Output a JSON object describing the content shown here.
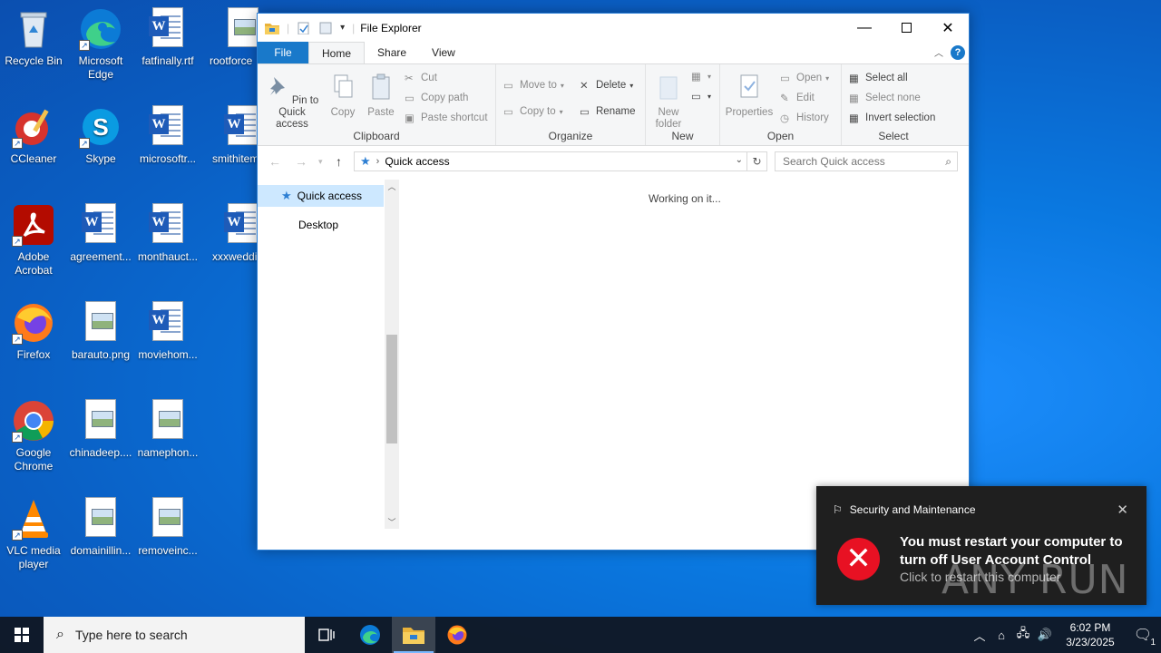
{
  "desktop": {
    "icons": [
      {
        "label": "Recycle Bin",
        "icon": "recycle-bin-icon"
      },
      {
        "label": "Microsoft Edge",
        "icon": "edge-icon"
      },
      {
        "label": "fatfinally.rtf",
        "icon": "word-doc-icon"
      },
      {
        "label": "rootforce",
        "icon": "image-file-icon"
      },
      {
        "label": "CCleaner",
        "icon": "ccleaner-icon"
      },
      {
        "label": "Skype",
        "icon": "skype-icon"
      },
      {
        "label": "microsoftr...",
        "icon": "word-doc-icon"
      },
      {
        "label": "smithitem",
        "icon": "word-doc-icon"
      },
      {
        "label": "Adobe Acrobat",
        "icon": "acrobat-icon"
      },
      {
        "label": "agreement...",
        "icon": "word-doc-icon"
      },
      {
        "label": "monthauct...",
        "icon": "word-doc-icon"
      },
      {
        "label": "xxxweddin",
        "icon": "word-doc-icon"
      },
      {
        "label": "Firefox",
        "icon": "firefox-icon"
      },
      {
        "label": "barauto.png",
        "icon": "image-file-icon"
      },
      {
        "label": "moviehom...",
        "icon": "word-doc-icon"
      },
      {
        "label": "Google Chrome",
        "icon": "chrome-icon"
      },
      {
        "label": "chinadeep....",
        "icon": "image-file-icon"
      },
      {
        "label": "namephon...",
        "icon": "image-file-icon"
      },
      {
        "label": "VLC media player",
        "icon": "vlc-icon"
      },
      {
        "label": "domainillin...",
        "icon": "image-file-icon"
      },
      {
        "label": "removeinc...",
        "icon": "image-file-icon"
      }
    ]
  },
  "explorer": {
    "title": "File Explorer",
    "tabs": {
      "file": "File",
      "home": "Home",
      "share": "Share",
      "view": "View"
    },
    "help": "?",
    "ribbon": {
      "clipboard": {
        "group": "Clipboard",
        "pin": "Pin to Quick access",
        "copy": "Copy",
        "paste": "Paste",
        "cut": "Cut",
        "copy_path": "Copy path",
        "paste_shortcut": "Paste shortcut"
      },
      "organize": {
        "group": "Organize",
        "move_to": "Move to",
        "copy_to": "Copy to",
        "delete": "Delete",
        "rename": "Rename"
      },
      "new": {
        "group": "New",
        "new_folder": "New folder"
      },
      "open": {
        "group": "Open",
        "properties": "Properties",
        "open": "Open",
        "edit": "Edit",
        "history": "History"
      },
      "select": {
        "group": "Select",
        "select_all": "Select all",
        "select_none": "Select none",
        "invert": "Invert selection"
      }
    },
    "address": {
      "location": "Quick access"
    },
    "search": {
      "placeholder": "Search Quick access"
    },
    "nav": {
      "quick_access": "Quick access",
      "desktop": "Desktop"
    },
    "status": "Working on it..."
  },
  "toast": {
    "app": "Security and Maintenance",
    "title": "You must restart your computer to turn off User Account Control",
    "subtitle": "Click to restart this computer",
    "status_color": "#e81123"
  },
  "watermark": "ANY RUN",
  "taskbar": {
    "search_placeholder": "Type here to search",
    "time": "6:02 PM",
    "date": "3/23/2025",
    "notification_count": "1"
  }
}
